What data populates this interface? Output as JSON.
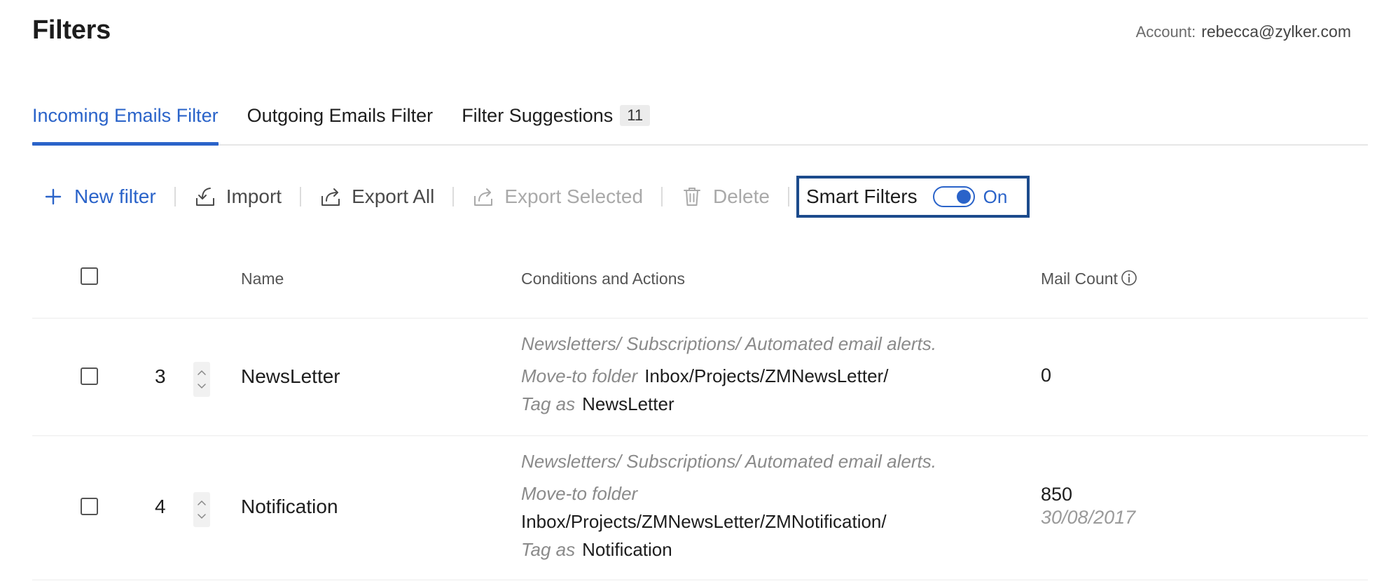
{
  "header": {
    "title": "Filters",
    "account_label": "Account:",
    "account_email": "rebecca@zylker.com"
  },
  "tabs": [
    {
      "label": "Incoming Emails Filter",
      "active": true
    },
    {
      "label": "Outgoing Emails Filter",
      "active": false
    },
    {
      "label": "Filter Suggestions",
      "badge": "11",
      "active": false
    }
  ],
  "toolbar": {
    "new_filter": "New filter",
    "import": "Import",
    "export_all": "Export All",
    "export_selected": "Export Selected",
    "delete": "Delete",
    "smart_filters_label": "Smart Filters",
    "smart_filters_state": "On",
    "smart_filters_enabled": true
  },
  "table": {
    "columns": {
      "name": "Name",
      "conditions": "Conditions and Actions",
      "mail_count": "Mail Count"
    },
    "rows": [
      {
        "order": "3",
        "name": "NewsLetter",
        "condition": "Newsletters/ Subscriptions/ Automated email alerts.",
        "move_label": "Move-to folder",
        "move_value": "Inbox/Projects/ZMNewsLetter/",
        "tag_label": "Tag as",
        "tag_value": "NewsLetter",
        "mail_count": "0",
        "date": ""
      },
      {
        "order": "4",
        "name": "Notification",
        "condition": "Newsletters/ Subscriptions/ Automated email alerts.",
        "move_label": "Move-to folder",
        "move_value": "Inbox/Projects/ZMNewsLetter/ZMNotification/",
        "tag_label": "Tag as",
        "tag_value": "Notification",
        "mail_count": "850",
        "date": "30/08/2017"
      }
    ]
  },
  "colors": {
    "accent": "#2a63c9",
    "highlight_border": "#1c4b8c",
    "muted_text": "#8a8a8a"
  }
}
